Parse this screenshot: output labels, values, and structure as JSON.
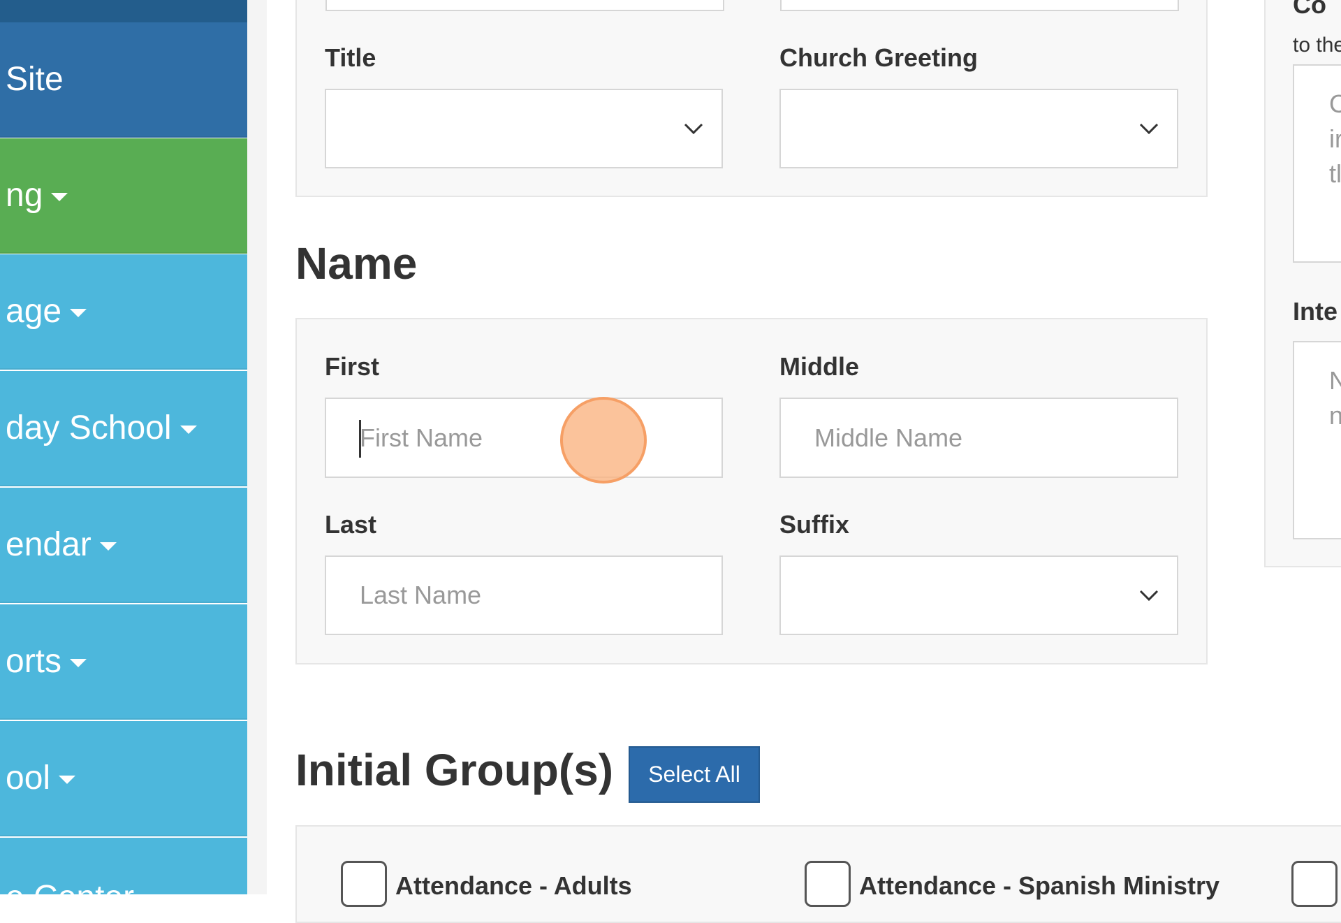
{
  "sidebar": {
    "items": [
      {
        "label": "Site",
        "has_caret": false
      },
      {
        "label": "ng",
        "has_caret": true
      },
      {
        "label": "age",
        "has_caret": true
      },
      {
        "label": "day School",
        "has_caret": true
      },
      {
        "label": "endar",
        "has_caret": true
      },
      {
        "label": "orts",
        "has_caret": true
      },
      {
        "label": "ool",
        "has_caret": true
      },
      {
        "label": "e Center",
        "has_caret": false
      }
    ],
    "colors": {
      "site": "#2f6ea6",
      "active": "#59ad53",
      "item": "#4db7dc"
    }
  },
  "title_panel": {
    "title_label": "Title",
    "title_value": "",
    "greeting_label": "Church Greeting",
    "greeting_value": ""
  },
  "name_section": {
    "heading": "Name",
    "first_label": "First",
    "first_placeholder": "First Name",
    "middle_label": "Middle",
    "middle_placeholder": "Middle Name",
    "last_label": "Last",
    "last_placeholder": "Last Name",
    "suffix_label": "Suffix",
    "suffix_value": ""
  },
  "groups_section": {
    "heading": "Initial Group(s)",
    "select_all_label": "Select All",
    "groups": [
      {
        "label": "Attendance - Adults",
        "checked": false
      },
      {
        "label": "Attendance - Spanish Ministry",
        "checked": false
      },
      {
        "label": "",
        "checked": false
      }
    ]
  },
  "right_column": {
    "heading_partial": "Co",
    "subtext_partial": "to the",
    "box1_lines": [
      "C",
      "ir",
      "tl"
    ],
    "heading2_partial": "Inte",
    "box2_lines": [
      "N",
      "n"
    ]
  },
  "accent_color": "#2c6bab"
}
